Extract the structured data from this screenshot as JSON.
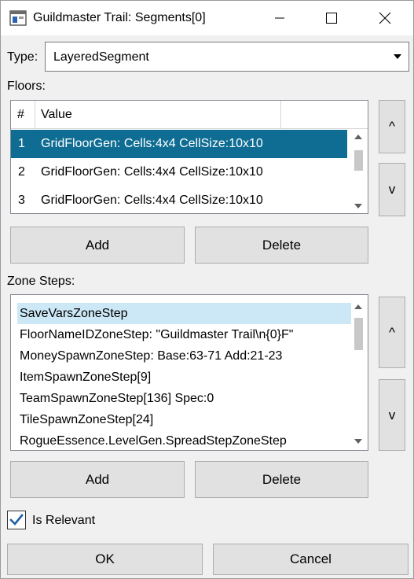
{
  "window": {
    "title": "Guildmaster Trail: Segments[0]",
    "icon": "app-window-icon",
    "caption_buttons": [
      "minimize-icon",
      "maximize-icon",
      "close-icon"
    ]
  },
  "type_field": {
    "label": "Type:",
    "value": "LayeredSegment"
  },
  "floors": {
    "label": "Floors:",
    "columns": [
      "#",
      "Value",
      ""
    ],
    "rows": [
      {
        "num": "1",
        "value": "GridFloorGen: Cells:4x4 CellSize:10x10",
        "selected": true
      },
      {
        "num": "2",
        "value": "GridFloorGen: Cells:4x4 CellSize:10x10",
        "selected": false
      },
      {
        "num": "3",
        "value": "GridFloorGen: Cells:4x4 CellSize:10x10",
        "selected": false
      }
    ],
    "up_label": "^",
    "down_label": "v",
    "add_label": "Add",
    "delete_label": "Delete"
  },
  "zone_steps": {
    "label": "Zone Steps:",
    "items": [
      "SaveVarsZoneStep",
      "FloorNameIDZoneStep: \"Guildmaster Trail\\n{0}F\"",
      "MoneySpawnZoneStep: Base:63-71 Add:21-23",
      "ItemSpawnZoneStep[9]",
      "TeamSpawnZoneStep[136] Spec:0",
      "TileSpawnZoneStep[24]",
      "RogueEssence.LevelGen.SpreadStepZoneStep"
    ],
    "selected_index": 0,
    "up_label": "^",
    "down_label": "v",
    "add_label": "Add",
    "delete_label": "Delete"
  },
  "is_relevant": {
    "label": "Is Relevant",
    "checked": true
  },
  "footer": {
    "ok_label": "OK",
    "cancel_label": "Cancel"
  },
  "colors": {
    "selection_dark": "#0f6d93",
    "selection_light": "#cce8f6",
    "checkbox_check": "#1b5fa6"
  }
}
